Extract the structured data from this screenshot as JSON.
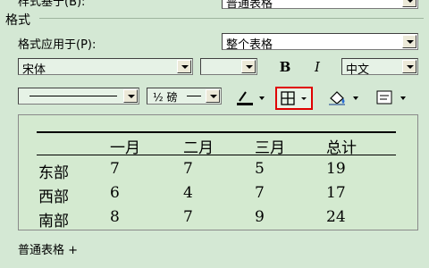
{
  "top_row": {
    "label": "样式基于(B):",
    "value": "普通表格"
  },
  "section_title": "格式",
  "apply_to": {
    "label": "格式应用于(P):",
    "value": "整个表格"
  },
  "font": {
    "name": "宋体",
    "size": "",
    "bold_label": "B",
    "italic_label": "I",
    "lang": "中文"
  },
  "border_toolbar": {
    "line_style_label": "",
    "line_width_label": "½ 磅",
    "borders_selected": true
  },
  "preview_table": {
    "headers": [
      "",
      "一月",
      "二月",
      "三月",
      "总计"
    ],
    "rows": [
      [
        "东部",
        "7",
        "7",
        "5",
        "19"
      ],
      [
        "西部",
        "6",
        "4",
        "7",
        "17"
      ],
      [
        "南部",
        "8",
        "7",
        "9",
        "24"
      ]
    ]
  },
  "description": "普通表格 +",
  "colors": {
    "dialog_bg": "#d4e8d4",
    "preview_bg": "#d4ead0",
    "highlight": "#e00000"
  }
}
